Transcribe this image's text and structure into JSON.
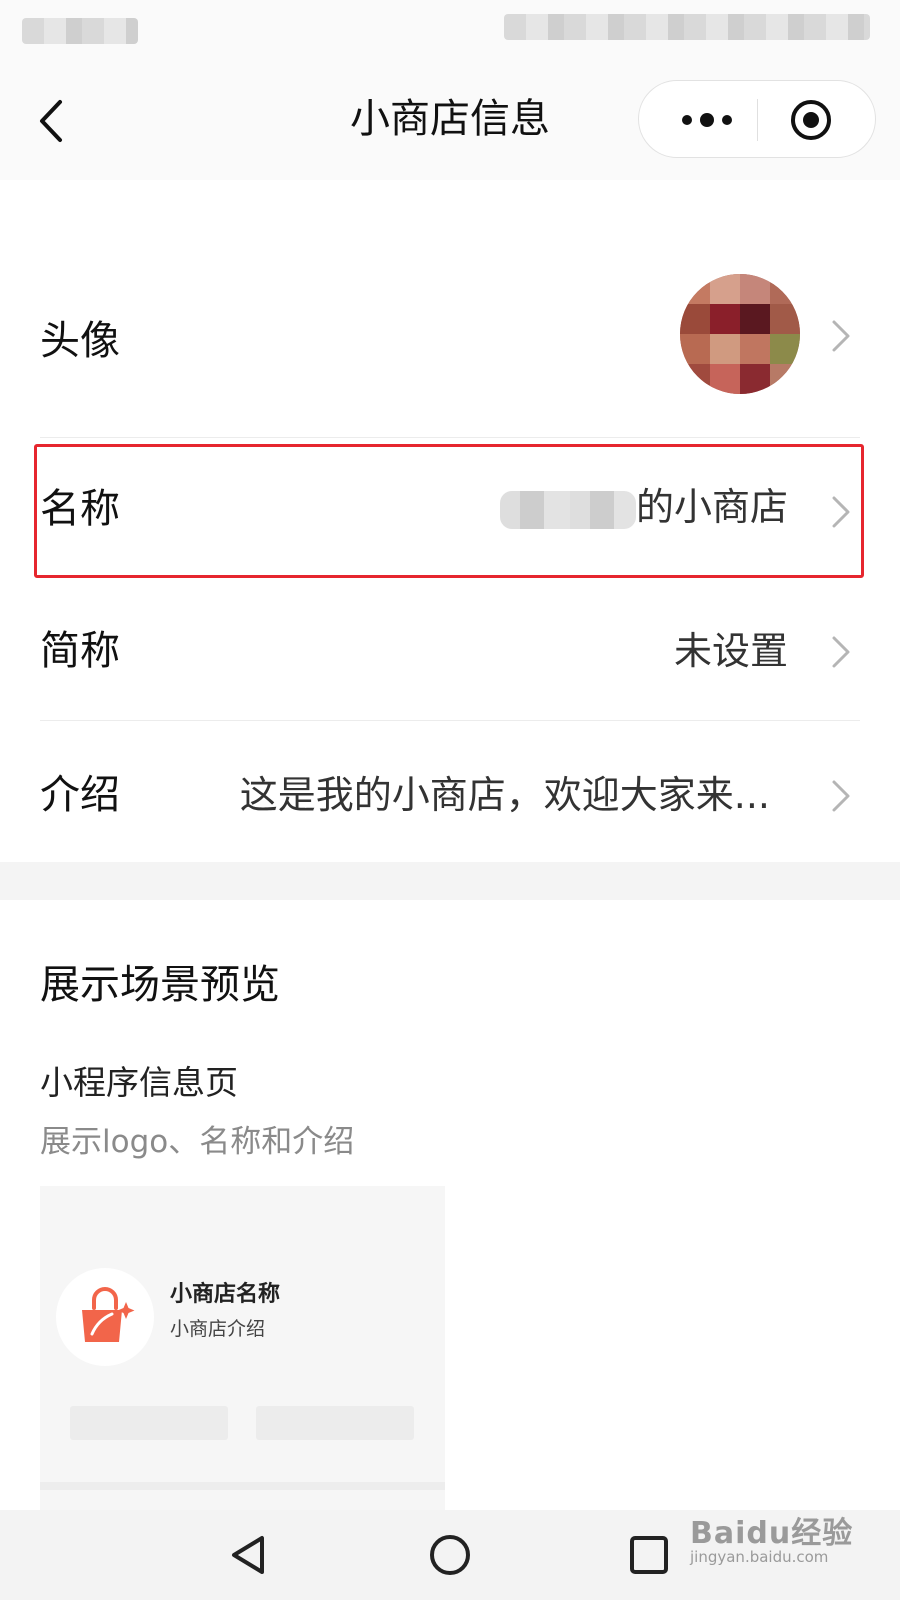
{
  "nav": {
    "title": "小商店信息"
  },
  "rows": [
    {
      "label": "头像",
      "value": ""
    },
    {
      "label": "名称",
      "value": "的小商店"
    },
    {
      "label": "简称",
      "value": "未设置"
    },
    {
      "label": "介绍",
      "value": "这是我的小商店，欢迎大家来..."
    }
  ],
  "preview": {
    "title": "展示场景预览",
    "subtitle": "小程序信息页",
    "description": "展示logo、名称和介绍",
    "card": {
      "name": "小商店名称",
      "intro": "小商店介绍"
    }
  },
  "watermark": {
    "main": "Baidu经验",
    "sub": "jingyan.baidu.com"
  },
  "colors": {
    "highlight": "#e6262e",
    "logo_accent": "#f2654a"
  },
  "icons": [
    "back-icon",
    "more-icon",
    "close-target-icon",
    "chevron-right-icon",
    "shopping-bag-icon",
    "nav-back-triangle-icon",
    "nav-home-circle-icon",
    "nav-recent-square-icon"
  ]
}
